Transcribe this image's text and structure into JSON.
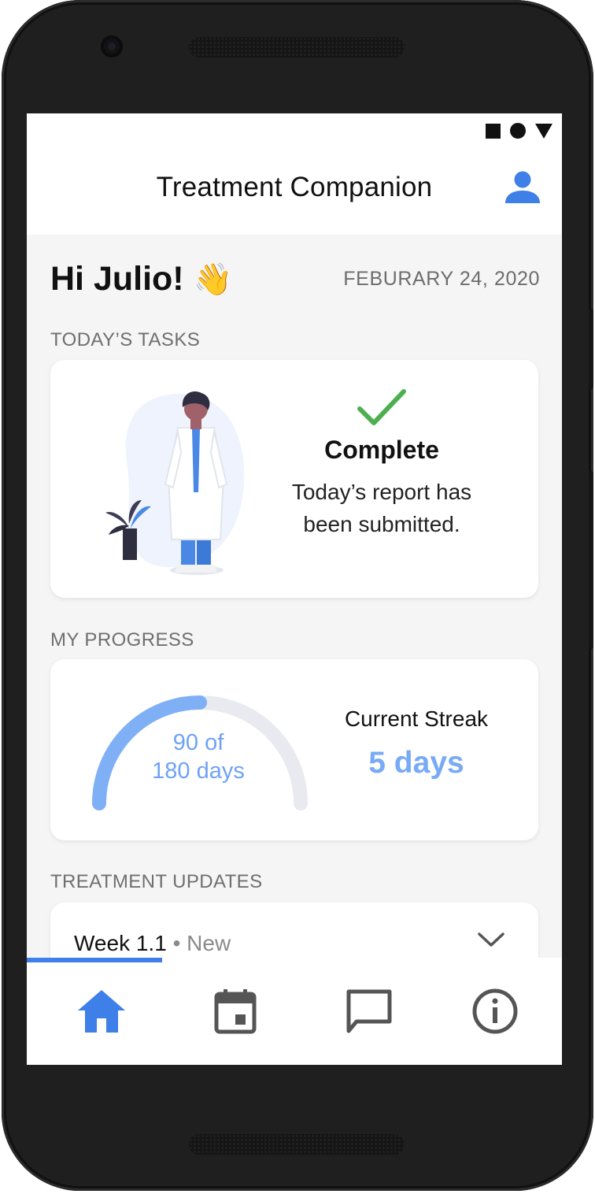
{
  "app": {
    "title": "Treatment Companion"
  },
  "status_icons": [
    "square-icon",
    "circle-icon",
    "triangle-icon"
  ],
  "header": {
    "greeting": "Hi Julio!",
    "wave_emoji": "👋",
    "date": "FEBURARY 24, 2020"
  },
  "tasks": {
    "section_label": "TODAY’S TASKS",
    "status": "Complete",
    "description": "Today’s report has been submitted.",
    "icon": "check-icon"
  },
  "progress": {
    "section_label": "MY PROGRESS",
    "days_done": 90,
    "days_total": 180,
    "gauge_line1": "90 of",
    "gauge_line2": "180 days",
    "streak_label": "Current Streak",
    "streak_value": "5 days"
  },
  "updates": {
    "section_label": "TREATMENT UPDATES",
    "items": [
      {
        "title": "Week 1.1",
        "separator": "•",
        "badge": "New"
      }
    ]
  },
  "nav": {
    "items": [
      {
        "name": "home",
        "icon": "home-icon",
        "active": true
      },
      {
        "name": "calendar",
        "icon": "calendar-icon",
        "active": false
      },
      {
        "name": "messages",
        "icon": "chat-icon",
        "active": false
      },
      {
        "name": "info",
        "icon": "info-icon",
        "active": false
      }
    ]
  },
  "colors": {
    "accent": "#3f7fe8",
    "gauge_fill": "#7fb0f6",
    "gauge_track": "#e8eaf0",
    "check": "#4caf50",
    "frame": "#1f1f1f",
    "background": "#f5f5f5"
  }
}
